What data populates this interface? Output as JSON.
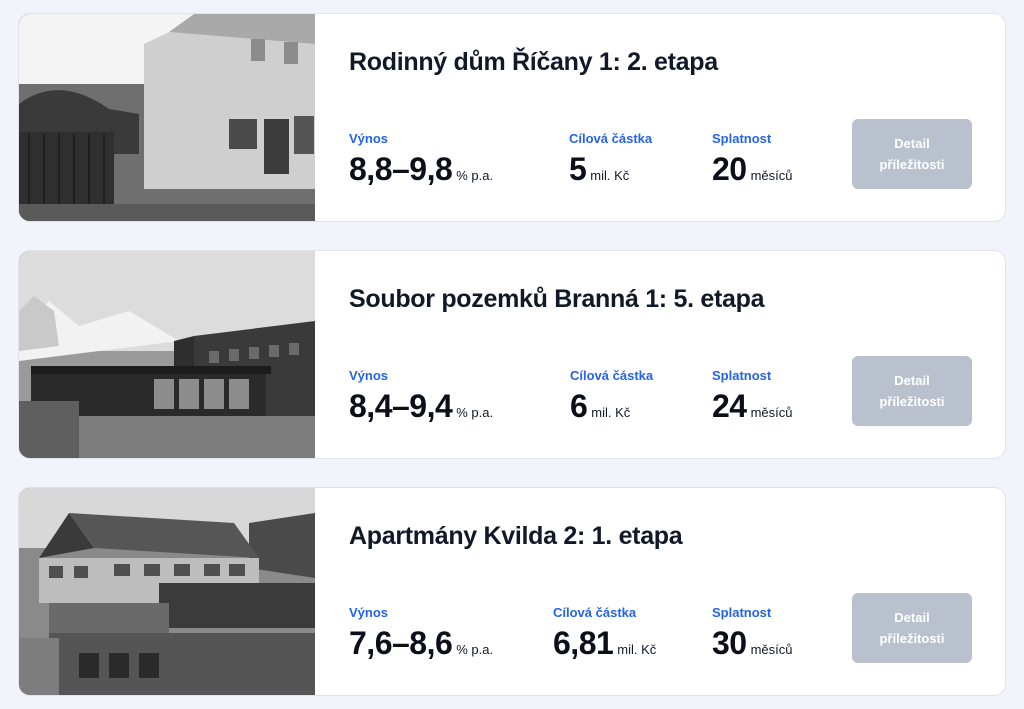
{
  "labels": {
    "yield": "Výnos",
    "target": "Cílová částka",
    "maturity": "Splatnost",
    "button_line1": "Detail",
    "button_line2": "příležitosti"
  },
  "projects": [
    {
      "title": "Rodinný dům Říčany 1: 2. etapa",
      "yield_value": "8,8–9,8",
      "yield_unit": "% p.a.",
      "target_value": "5",
      "target_unit": "mil. Kč",
      "maturity_value": "20",
      "maturity_unit": "měsíců",
      "image": "grayscale photo of an old house with a wooden fence"
    },
    {
      "title": "Soubor pozemků Branná 1: 5. etapa",
      "yield_value": "8,4–9,4",
      "yield_unit": "% p.a.",
      "target_value": "6",
      "target_unit": "mil. Kč",
      "maturity_value": "24",
      "maturity_unit": "měsíců",
      "image": "grayscale rendering of modern dark buildings with mountains"
    },
    {
      "title": "Apartmány Kvilda 2: 1. etapa",
      "yield_value": "7,6–8,6",
      "yield_unit": "% p.a.",
      "target_value": "6,81",
      "target_unit": "mil. Kč",
      "maturity_value": "30",
      "maturity_unit": "měsíců",
      "image": "grayscale aerial rendering of an apartment building"
    }
  ]
}
